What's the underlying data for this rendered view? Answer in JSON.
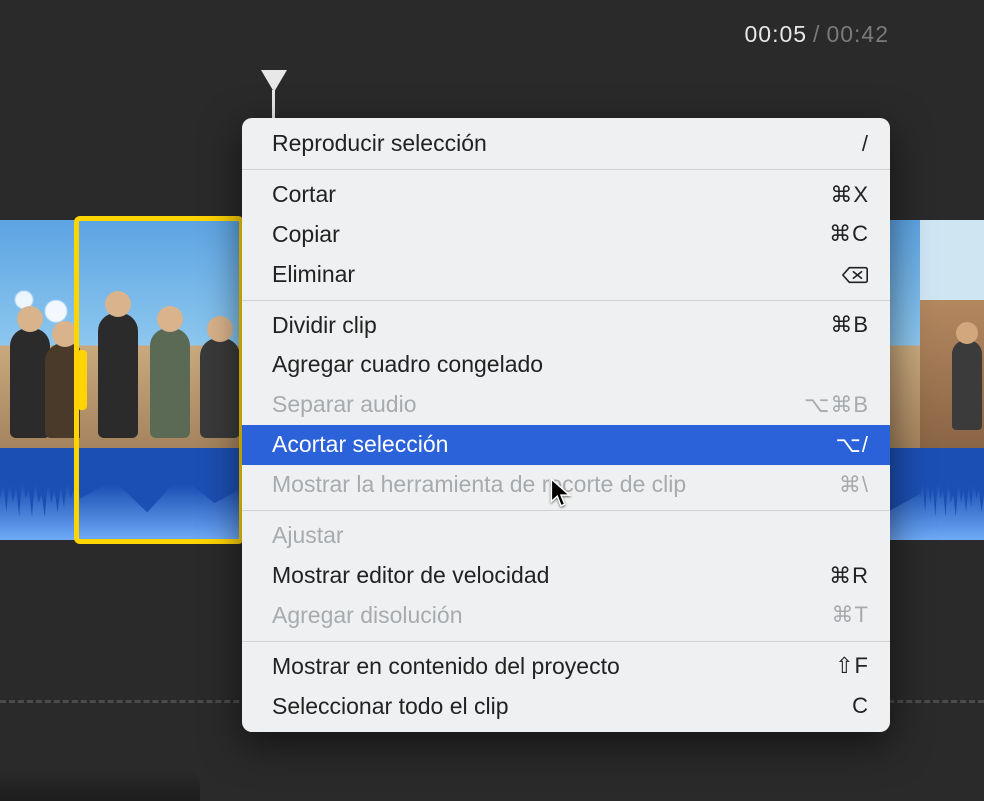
{
  "timecode": {
    "current": "00:05",
    "separator": "/",
    "total": "00:42"
  },
  "menu": {
    "items": [
      {
        "label": "Reproducir selección",
        "shortcut": "/",
        "enabled": true
      },
      {
        "separator": true
      },
      {
        "label": "Cortar",
        "shortcut": "⌘X",
        "enabled": true
      },
      {
        "label": "Copiar",
        "shortcut": "⌘C",
        "enabled": true
      },
      {
        "label": "Eliminar",
        "shortcut": "delete-icon",
        "enabled": true
      },
      {
        "separator": true
      },
      {
        "label": "Dividir clip",
        "shortcut": "⌘B",
        "enabled": true
      },
      {
        "label": "Agregar cuadro congelado",
        "shortcut": "",
        "enabled": true
      },
      {
        "label": "Separar audio",
        "shortcut": "⌥⌘B",
        "enabled": false
      },
      {
        "label": "Acortar selección",
        "shortcut": "⌥/",
        "enabled": true,
        "hovered": true
      },
      {
        "label": "Mostrar la herramienta de recorte de clip",
        "shortcut": "⌘\\",
        "enabled": false
      },
      {
        "separator": true
      },
      {
        "label": "Ajustar",
        "shortcut": "",
        "enabled": false
      },
      {
        "label": "Mostrar editor de velocidad",
        "shortcut": "⌘R",
        "enabled": true
      },
      {
        "label": "Agregar disolución",
        "shortcut": "⌘T",
        "enabled": false
      },
      {
        "separator": true
      },
      {
        "label": "Mostrar en contenido del proyecto",
        "shortcut": "⇧F",
        "enabled": true
      },
      {
        "label": "Seleccionar todo el clip",
        "shortcut": "C",
        "enabled": true
      }
    ]
  }
}
